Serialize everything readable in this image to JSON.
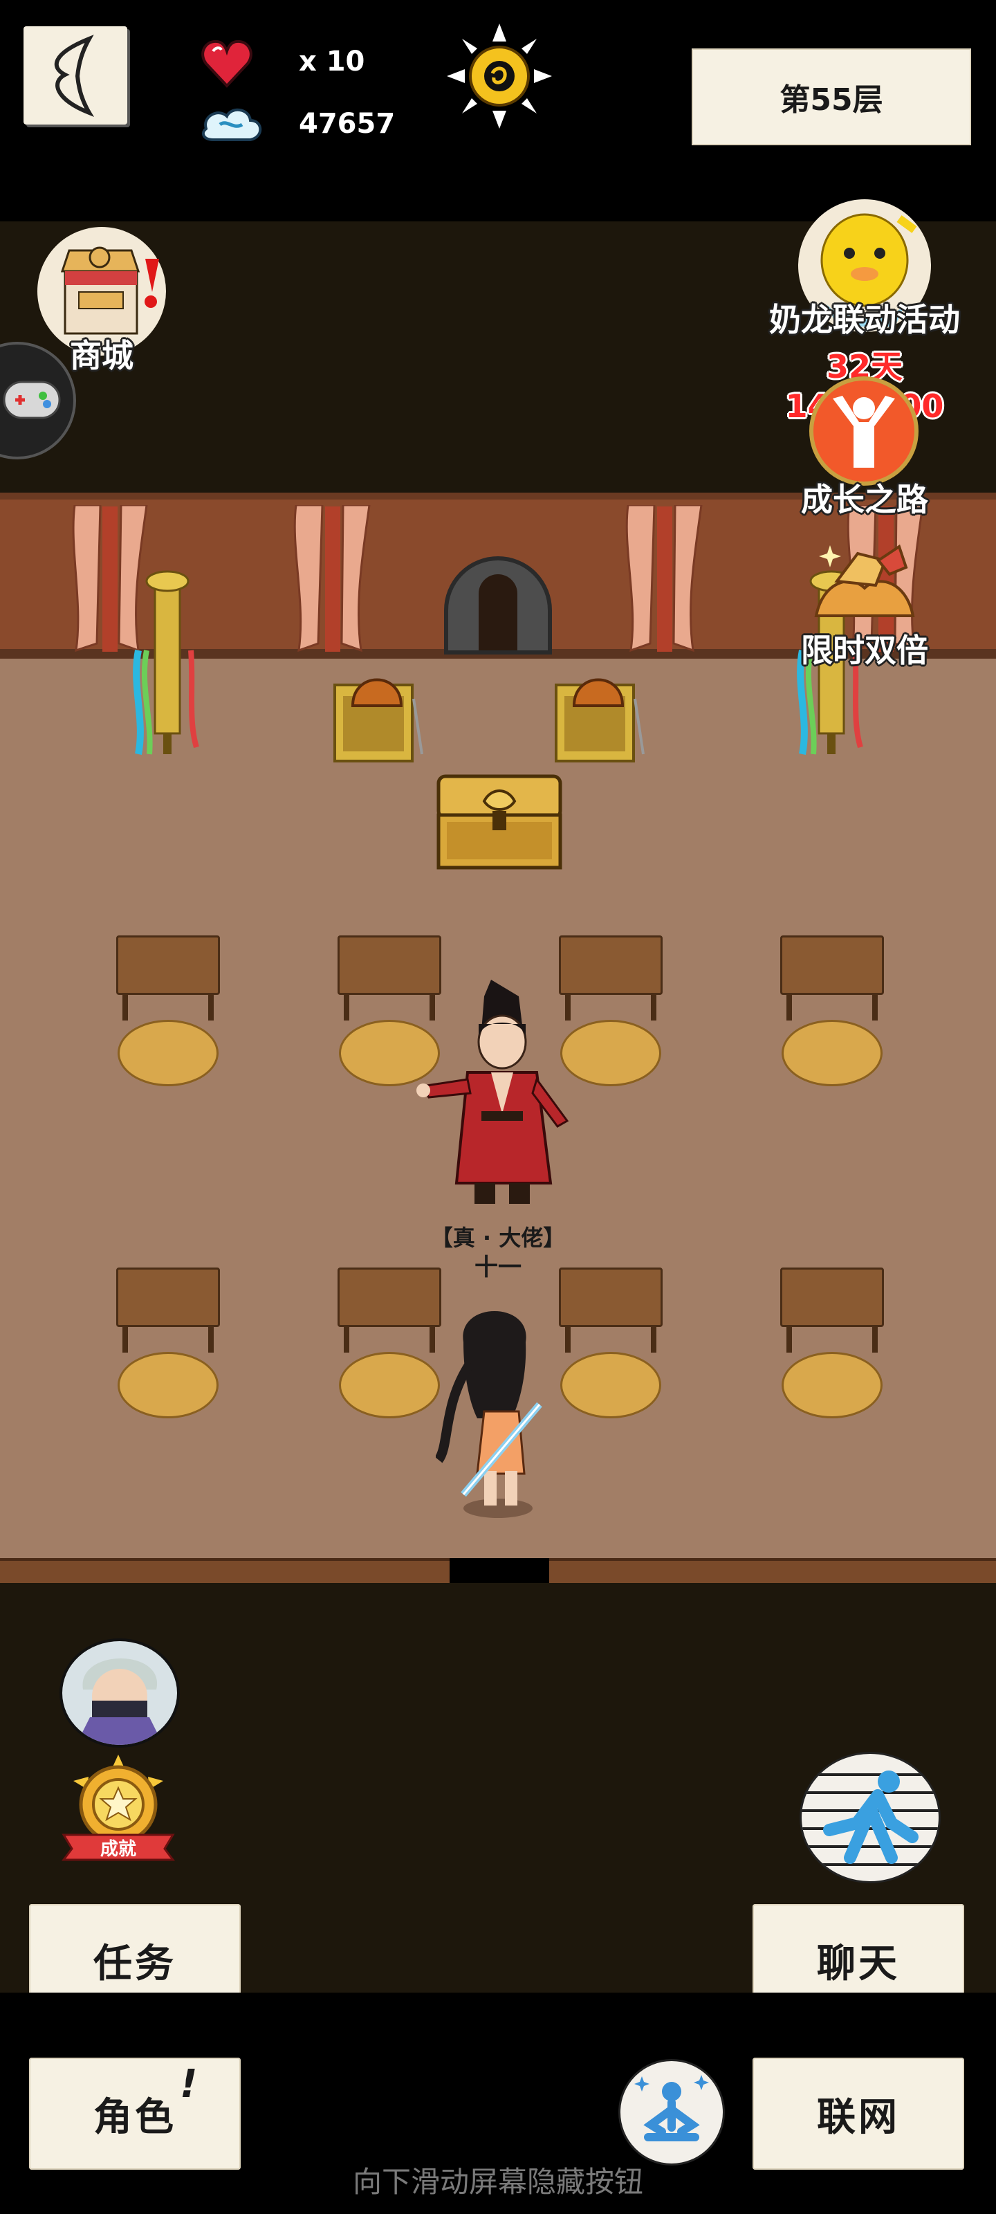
{
  "header": {
    "back_icon": "back-arrow-icon",
    "lives": "x 10",
    "currency": "47657",
    "floor": "第55层"
  },
  "left_menu": {
    "shop_label": "商城"
  },
  "right_menu": {
    "event_title": "奶龙联动活动",
    "event_timer": "32天14:40:00",
    "growth_label": "成长之路",
    "double_label": "限时双倍"
  },
  "npc": {
    "title": "【真 · 大佬】",
    "name": "十一"
  },
  "bottom": {
    "achievement_badge": "成就",
    "task_label": "任务",
    "chat_label": "聊天",
    "role_label": "角色",
    "role_alert": "!",
    "online_label": "联网",
    "hint": "向下滑动屏幕隐藏按钮"
  },
  "colors": {
    "floor": "#a27e66",
    "wall": "#8a4a2c",
    "dark_band": "#1d170c",
    "timer_red": "#ff2a2a"
  }
}
